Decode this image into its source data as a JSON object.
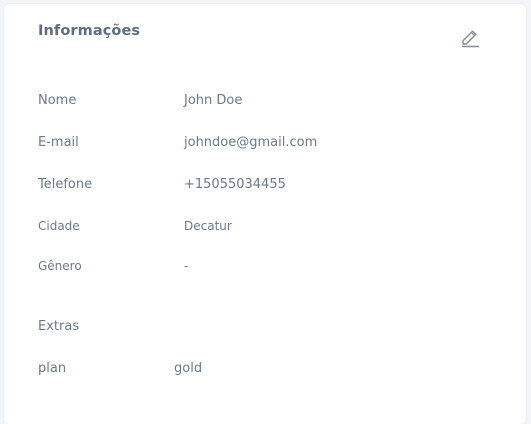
{
  "panel": {
    "title": "Informações",
    "edit_icon": "pencil-icon"
  },
  "fields": [
    {
      "label": "Nome",
      "value": "John Doe"
    },
    {
      "label": "E-mail",
      "value": "johndoe@gmail.com"
    },
    {
      "label": "Telefone",
      "value": "+15055034455"
    },
    {
      "label": "Cidade",
      "value": "Decatur"
    },
    {
      "label": "Gênero",
      "value": "-"
    }
  ],
  "extras": {
    "heading": "Extras",
    "items": [
      {
        "label": "plan",
        "value": "gold"
      }
    ]
  },
  "colors": {
    "text": "#6b7a8d",
    "title": "#5f6d82",
    "icon": "#7f8ea1",
    "background": "#f3f5f8",
    "card": "#ffffff"
  }
}
